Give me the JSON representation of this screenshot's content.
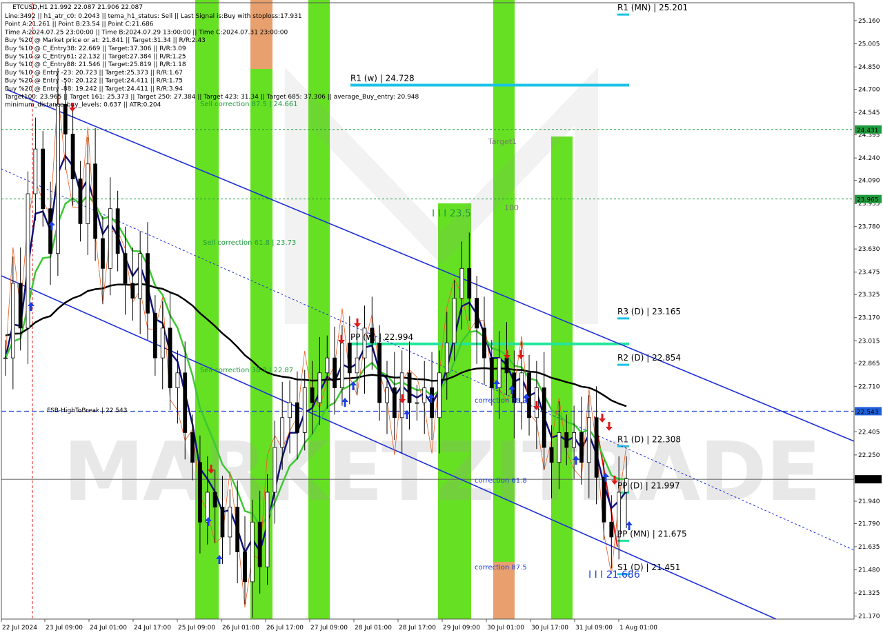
{
  "chart_data": {
    "type": "candlestick",
    "symbol_header": "ETCUSD,H1  21.992 22.087 21.906 22.087",
    "info_lines": [
      "Line:3492 || h1_atr_c0: 0.2043 || tema_h1_status: Sell || Last Signal is:Buy with stoploss:17.931",
      "Point A:21.261 || Point B:23.54 || Point C:21.686",
      "Time A:2024.07.25 23:00:00 || Time B:2024.07.29 13:00:00 || Time C:2024.07.31 23:00:00",
      "Buy %20 @ Market price or at: 21.841 || Target:31.34 || R/R:2.43",
      "Buy %10 @ C_Entry38: 22.669 || Target:37.306 || R/R:3.09",
      "Buy %10 @ C_Entry61: 22.132 || Target:27.384 || R/R:1.25",
      "Buy %10 @ C_Entry88: 21.546 || Target:25.819 || R/R:1.18",
      "Buy %10 @ Entry -23: 20.723 || Target:25.373 || R/R:1.67",
      "Buy %20 @ Entry -50: 20.122 || Target:24.411 || R/R:1.75",
      "Buy %20 @ Entry -88: 19.242 || Target:24.411 || R/R:3.94",
      "Target100: 23.965 || Target 161: 25.373 || Target 250: 27.384 || Target 423: 31.34 || Target 685: 37.306 || average_Buy_entry: 20.948",
      "minimum_distance_buy_levels: 0.637 || ATR:0.204"
    ],
    "y_axis": {
      "range": [
        21.15,
        25.28
      ],
      "ticks": [
        "25.160",
        "25.005",
        "24.850",
        "24.700",
        "24.545",
        "24.395",
        "24.240",
        "24.090",
        "23.935",
        "23.780",
        "23.630",
        "23.475",
        "23.325",
        "23.170",
        "23.015",
        "22.865",
        "22.710",
        "22.555",
        "22.405",
        "22.250",
        "22.095",
        "21.940",
        "21.790",
        "21.635",
        "21.480",
        "21.325",
        "21.170"
      ]
    },
    "x_axis": {
      "ticks": [
        "22 Jul 2024",
        "23 Jul 09:00",
        "24 Jul 01:00",
        "24 Jul 17:00",
        "25 Jul 09:00",
        "26 Jul 01:00",
        "26 Jul 17:00",
        "27 Jul 09:00",
        "28 Jul 01:00",
        "28 Jul 17:00",
        "29 Jul 09:00",
        "30 Jul 01:00",
        "30 Jul 17:00",
        "31 Jul 09:00",
        "1 Aug 01:00"
      ]
    },
    "current_price": "22.087",
    "price_tags": [
      {
        "value": 24.431,
        "text": "24.431",
        "color": "#1e9b3c"
      },
      {
        "value": 23.965,
        "text": "23.965",
        "color": "#1e9b3c"
      },
      {
        "value": 22.543,
        "text": "22.543",
        "color": "#1e5fd8"
      },
      {
        "value": 22.087,
        "text": "22.087",
        "color": "#000000"
      }
    ],
    "levels": [
      {
        "label": "R1 (MN) | 25.201",
        "value": 25.201,
        "color": "#19c3e6"
      },
      {
        "label": "R1 (w) | 24.728",
        "value": 24.728,
        "color": "#19c3e6"
      },
      {
        "label": "R3 (D) | 23.165",
        "value": 23.165,
        "color": "#19c3e6"
      },
      {
        "label": "PP (w) | 22.994",
        "value": 22.994,
        "color": "#20e69a"
      },
      {
        "label": "R2 (D) | 22.854",
        "value": 22.854,
        "color": "#19c3e6"
      },
      {
        "label": "R1 (D) | 22.308",
        "value": 22.308,
        "color": "#19c3e6"
      },
      {
        "label": "PP (D) | 21.997",
        "value": 21.997,
        "color": "#20e69a"
      },
      {
        "label": "PP (MN) | 21.675",
        "value": 21.675,
        "color": "#20e69a"
      },
      {
        "label": "S1 (D) | 21.451",
        "value": 21.451,
        "color": "#19c3e6"
      }
    ],
    "annotations": [
      {
        "text": "Target1",
        "color": "#777777"
      },
      {
        "text": "100",
        "color": "#777777"
      },
      {
        "text": "I I I 23.5",
        "color": "#1e9b3c"
      },
      {
        "text": "Sell correction 87.5 | 24.661",
        "color": "#1e9b3c"
      },
      {
        "text": "Sell correction 61.8 | 23.73",
        "color": "#1e9b3c"
      },
      {
        "text": "Sell correction 38.2 | 22.87",
        "color": "#1e9b3c"
      },
      {
        "text": "FSB-HighToBreak | 22.543",
        "color": "#000000"
      },
      {
        "text": "correction 38.2",
        "color": "#1e3fd8"
      },
      {
        "text": "correction 61.8",
        "color": "#1e3fd8"
      },
      {
        "text": "correction 87.5",
        "color": "#1e3fd8"
      },
      {
        "text": "I I I 21.686",
        "color": "#1e3fd8"
      }
    ],
    "close_series": [
      22.9,
      23.4,
      23.1,
      24.0,
      24.3,
      23.9,
      23.6,
      24.6,
      24.4,
      24.1,
      23.8,
      24.2,
      23.7,
      23.5,
      23.9,
      23.6,
      23.4,
      23.3,
      23.6,
      23.2,
      22.9,
      23.1,
      22.7,
      22.8,
      22.4,
      22.2,
      21.8,
      22.0,
      21.9,
      21.7,
      21.9,
      21.6,
      21.4,
      21.8,
      21.5,
      22.0,
      22.3,
      22.5,
      22.6,
      22.4,
      22.7,
      22.6,
      22.8,
      22.9,
      22.7,
      23.0,
      22.8,
      22.9,
      23.1,
      23.0,
      22.6,
      22.7,
      22.5,
      22.8,
      22.6,
      22.6,
      22.7,
      22.5,
      22.8,
      23.0,
      23.3,
      23.5,
      23.3,
      23.1,
      22.9,
      22.7,
      22.9,
      22.8,
      22.6,
      22.8,
      22.5,
      22.7,
      22.3,
      22.2,
      22.4,
      22.3,
      22.4,
      22.2,
      22.5,
      22.1,
      21.8,
      21.7,
      22.0,
      22.09
    ],
    "colors": {
      "bullish_zone": "#66e022",
      "bearish_zone": "#e8a06e",
      "channel": "#1e2fd8",
      "ema_fast": "#11117a",
      "ema_mid": "#3cc832",
      "ema_slow": "#000000"
    },
    "watermark": "MARKETZITRADE"
  }
}
